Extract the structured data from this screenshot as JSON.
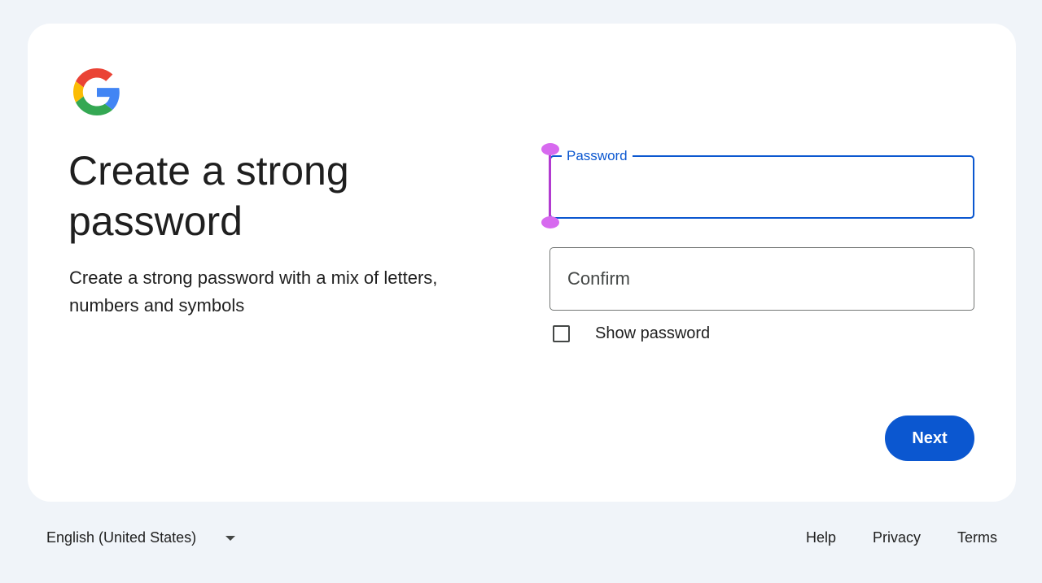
{
  "brand": {
    "logo_icon": "google-g-logo",
    "colors": {
      "red": "#ea4335",
      "yellow": "#fbbc05",
      "green": "#34a853",
      "blue": "#4285f4"
    }
  },
  "heading": {
    "title": "Create a strong password",
    "subtitle": "Create a strong password with a mix of letters, numbers and symbols"
  },
  "form": {
    "password": {
      "label": "Password",
      "value": "",
      "focused": true
    },
    "confirm": {
      "placeholder": "Confirm",
      "value": ""
    },
    "show_password": {
      "label": "Show password",
      "checked": false
    },
    "next_label": "Next"
  },
  "footer": {
    "language": "English (United States)",
    "links": [
      "Help",
      "Privacy",
      "Terms"
    ]
  },
  "accent": "#0b57d0"
}
